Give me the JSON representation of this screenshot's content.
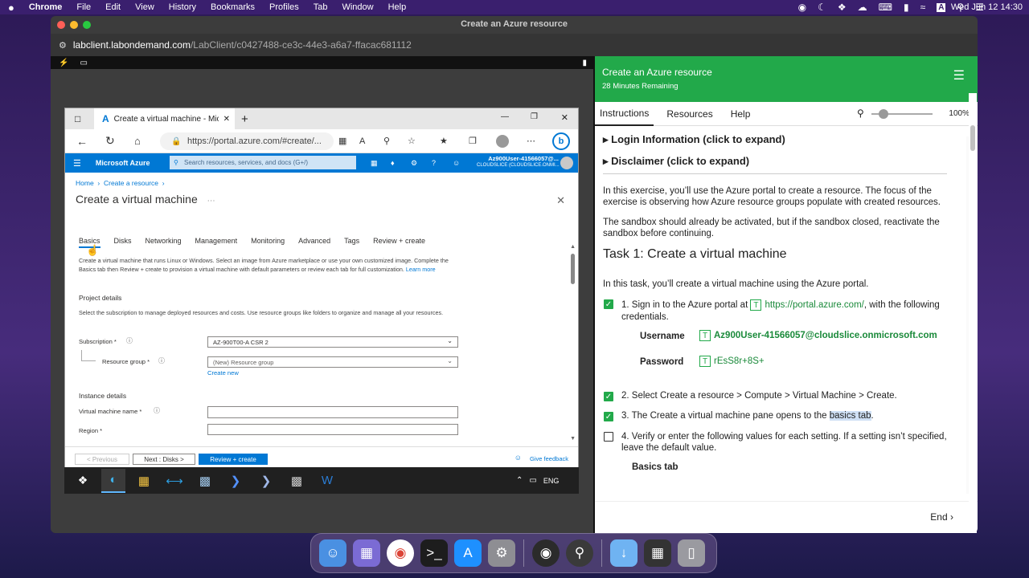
{
  "mac_menubar": {
    "apple": "",
    "app": "Chrome",
    "menus": [
      "File",
      "Edit",
      "View",
      "History",
      "Bookmarks",
      "Profiles",
      "Tab",
      "Window",
      "Help"
    ],
    "clock": "Wed Jun 12  14:30",
    "input_source": "A"
  },
  "chrome": {
    "window_title": "Create an Azure resource",
    "url_host": "labclient.labondemand.com",
    "url_path": "/LabClient/c0427488-ce3c-44e3-a6a7-ffacac681112"
  },
  "edge": {
    "tab_title": "Create a virtual machine - Micros",
    "address": "https://portal.azure.com/#create/..."
  },
  "azure": {
    "brand": "Microsoft Azure",
    "search_placeholder": "Search resources, services, and docs (G+/)",
    "account": "Az900User-41566057@...",
    "tenant": "CLOUDSLICE (CLOUDSLICE.ONMI...",
    "breadcrumb": [
      "Home",
      "Create a resource"
    ],
    "page_title": "Create a virtual machine",
    "tabs": [
      "Basics",
      "Disks",
      "Networking",
      "Management",
      "Monitoring",
      "Advanced",
      "Tags",
      "Review + create"
    ],
    "intro": "Create a virtual machine that runs Linux or Windows. Select an image from Azure marketplace or use your own customized image. Complete the Basics tab then Review + create to provision a virtual machine with default parameters or review each tab for full customization.",
    "learn_more": "Learn more",
    "project_details": "Project details",
    "project_desc": "Select the subscription to manage deployed resources and costs. Use resource groups like folders to organize and manage all your resources.",
    "subscription_label": "Subscription *",
    "subscription_value": "AZ-900T00-A CSR 2",
    "rg_label": "Resource group *",
    "rg_value": "(New) Resource group",
    "create_new": "Create new",
    "instance_details": "Instance details",
    "vm_name_label": "Virtual machine name *",
    "region_label": "Region *",
    "btn_previous": "< Previous",
    "btn_next": "Next : Disks >",
    "btn_review": "Review + create",
    "feedback": "Give feedback"
  },
  "win_taskbar": {
    "lang": "ENG"
  },
  "lab": {
    "title": "Create an Azure resource",
    "remaining": "28 Minutes Remaining",
    "tabs": [
      "Instructions",
      "Resources",
      "Help"
    ],
    "zoom": "100%",
    "zoom_level": 0.2,
    "login_info": "Login Information (click to expand)",
    "disclaimer": "Disclaimer (click to expand)",
    "p1": "In this exercise, you’ll use the Azure portal to create a resource. The focus of the exercise is observing how Azure resource groups populate with created resources.",
    "p2": "The sandbox should already be activated, but if the sandbox closed, reactivate the sandbox before continuing.",
    "task_title": "Task 1: Create a virtual machine",
    "task_intro": "In this task, you’ll create a virtual machine using the Azure portal.",
    "step1_a": "1. Sign in to the Azure portal at",
    "step1_link": "https://portal.azure.com/",
    "step1_b": ", with the following",
    "step1_c": "credentials.",
    "username_label": "Username",
    "username_value": "Az900User-41566057@cloudslice.onmicrosoft.com",
    "password_label": "Password",
    "password_value": "rEsS8r+8S+",
    "step2": "2. Select Create a resource > Compute > Virtual Machine > Create.",
    "step3_a": "3. The Create a virtual machine pane opens to the",
    "step3_hl": "basics tab",
    "step3_b": ".",
    "step4_a": "4. Verify or enter the following values for each setting. If a setting isn’t specified,",
    "step4_b": "leave the default value.",
    "basics_tab": "Basics tab",
    "end": "End"
  }
}
